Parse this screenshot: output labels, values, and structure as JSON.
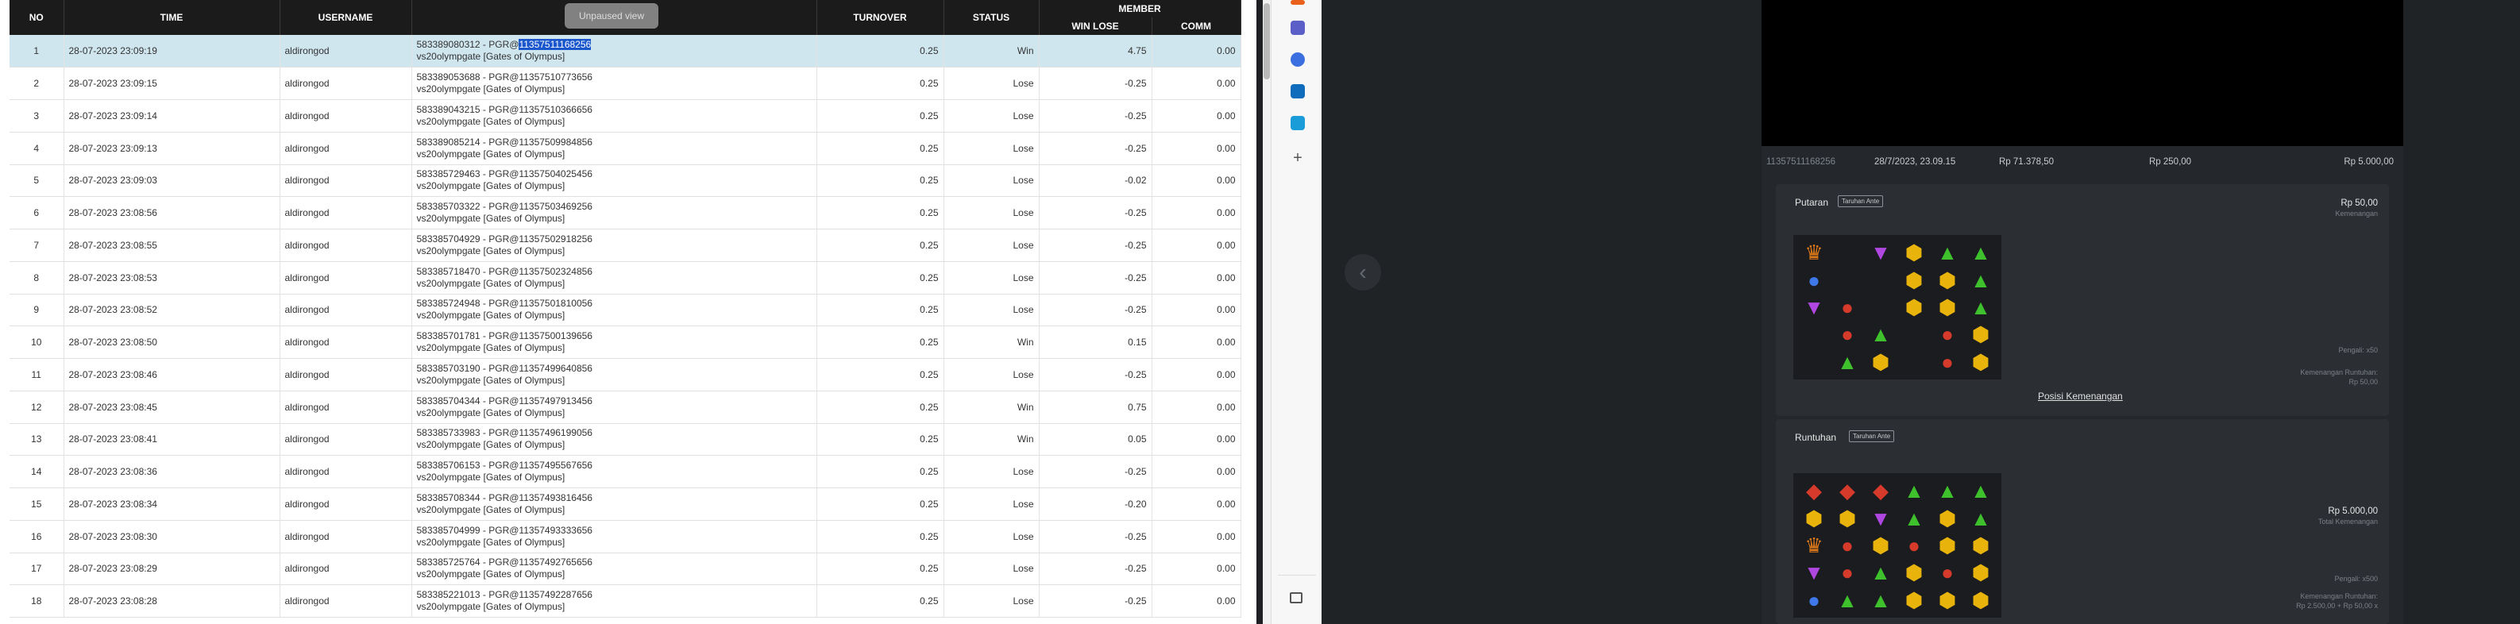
{
  "table": {
    "headers": {
      "no": "NO",
      "time": "TIME",
      "username": "USERNAME",
      "info": "",
      "turnover": "TURNOVER",
      "status": "STATUS",
      "member": "MEMBER",
      "win_lose": "WIN LOSE",
      "comm": "COMM"
    },
    "tooltip": "Unpaused view",
    "rows": [
      {
        "no": "1",
        "time": "28-07-2023 23:09:19",
        "user": "aldirongod",
        "l1a": "583389080312 - PGR@",
        "l1b": "11357511168256",
        "l2": "vs20olympgate [Gates of Olympus]",
        "turnover": "0.25",
        "status": "Win",
        "winlose": "4.75",
        "comm": "0.00"
      },
      {
        "no": "2",
        "time": "28-07-2023 23:09:15",
        "user": "aldirongod",
        "l1a": "583389053688 - PGR@11357510773656",
        "l1b": "",
        "l2": "vs20olympgate [Gates of Olympus]",
        "turnover": "0.25",
        "status": "Lose",
        "winlose": "-0.25",
        "comm": "0.00"
      },
      {
        "no": "3",
        "time": "28-07-2023 23:09:14",
        "user": "aldirongod",
        "l1a": "583389043215 - PGR@11357510366656",
        "l1b": "",
        "l2": "vs20olympgate [Gates of Olympus]",
        "turnover": "0.25",
        "status": "Lose",
        "winlose": "-0.25",
        "comm": "0.00"
      },
      {
        "no": "4",
        "time": "28-07-2023 23:09:13",
        "user": "aldirongod",
        "l1a": "583389085214 - PGR@11357509984856",
        "l1b": "",
        "l2": "vs20olympgate [Gates of Olympus]",
        "turnover": "0.25",
        "status": "Lose",
        "winlose": "-0.25",
        "comm": "0.00"
      },
      {
        "no": "5",
        "time": "28-07-2023 23:09:03",
        "user": "aldirongod",
        "l1a": "583385729463 - PGR@11357504025456",
        "l1b": "",
        "l2": "vs20olympgate [Gates of Olympus]",
        "turnover": "0.25",
        "status": "Lose",
        "winlose": "-0.02",
        "comm": "0.00"
      },
      {
        "no": "6",
        "time": "28-07-2023 23:08:56",
        "user": "aldirongod",
        "l1a": "583385703322 - PGR@11357503469256",
        "l1b": "",
        "l2": "vs20olympgate [Gates of Olympus]",
        "turnover": "0.25",
        "status": "Lose",
        "winlose": "-0.25",
        "comm": "0.00"
      },
      {
        "no": "7",
        "time": "28-07-2023 23:08:55",
        "user": "aldirongod",
        "l1a": "583385704929 - PGR@11357502918256",
        "l1b": "",
        "l2": "vs20olympgate [Gates of Olympus]",
        "turnover": "0.25",
        "status": "Lose",
        "winlose": "-0.25",
        "comm": "0.00"
      },
      {
        "no": "8",
        "time": "28-07-2023 23:08:53",
        "user": "aldirongod",
        "l1a": "583385718470 - PGR@11357502324856",
        "l1b": "",
        "l2": "vs20olympgate [Gates of Olympus]",
        "turnover": "0.25",
        "status": "Lose",
        "winlose": "-0.25",
        "comm": "0.00"
      },
      {
        "no": "9",
        "time": "28-07-2023 23:08:52",
        "user": "aldirongod",
        "l1a": "583385724948 - PGR@11357501810056",
        "l1b": "",
        "l2": "vs20olympgate [Gates of Olympus]",
        "turnover": "0.25",
        "status": "Lose",
        "winlose": "-0.25",
        "comm": "0.00"
      },
      {
        "no": "10",
        "time": "28-07-2023 23:08:50",
        "user": "aldirongod",
        "l1a": "583385701781 - PGR@11357500139656",
        "l1b": "",
        "l2": "vs20olympgate [Gates of Olympus]",
        "turnover": "0.25",
        "status": "Win",
        "winlose": "0.15",
        "comm": "0.00"
      },
      {
        "no": "11",
        "time": "28-07-2023 23:08:46",
        "user": "aldirongod",
        "l1a": "583385703190 - PGR@11357499640856",
        "l1b": "",
        "l2": "vs20olympgate [Gates of Olympus]",
        "turnover": "0.25",
        "status": "Lose",
        "winlose": "-0.25",
        "comm": "0.00"
      },
      {
        "no": "12",
        "time": "28-07-2023 23:08:45",
        "user": "aldirongod",
        "l1a": "583385704344 - PGR@11357497913456",
        "l1b": "",
        "l2": "vs20olympgate [Gates of Olympus]",
        "turnover": "0.25",
        "status": "Win",
        "winlose": "0.75",
        "comm": "0.00"
      },
      {
        "no": "13",
        "time": "28-07-2023 23:08:41",
        "user": "aldirongod",
        "l1a": "583385733983 - PGR@11357496199056",
        "l1b": "",
        "l2": "vs20olympgate [Gates of Olympus]",
        "turnover": "0.25",
        "status": "Win",
        "winlose": "0.05",
        "comm": "0.00"
      },
      {
        "no": "14",
        "time": "28-07-2023 23:08:36",
        "user": "aldirongod",
        "l1a": "583385706153 - PGR@11357495567656",
        "l1b": "",
        "l2": "vs20olympgate [Gates of Olympus]",
        "turnover": "0.25",
        "status": "Lose",
        "winlose": "-0.25",
        "comm": "0.00"
      },
      {
        "no": "15",
        "time": "28-07-2023 23:08:34",
        "user": "aldirongod",
        "l1a": "583385708344 - PGR@11357493816456",
        "l1b": "",
        "l2": "vs20olympgate [Gates of Olympus]",
        "turnover": "0.25",
        "status": "Lose",
        "winlose": "-0.20",
        "comm": "0.00"
      },
      {
        "no": "16",
        "time": "28-07-2023 23:08:30",
        "user": "aldirongod",
        "l1a": "583385704999 - PGR@11357493333656",
        "l1b": "",
        "l2": "vs20olympgate [Gates of Olympus]",
        "turnover": "0.25",
        "status": "Lose",
        "winlose": "-0.25",
        "comm": "0.00"
      },
      {
        "no": "17",
        "time": "28-07-2023 23:08:29",
        "user": "aldirongod",
        "l1a": "583385725764 - PGR@11357492765656",
        "l1b": "",
        "l2": "vs20olympgate [Gates of Olympus]",
        "turnover": "0.25",
        "status": "Lose",
        "winlose": "-0.25",
        "comm": "0.00"
      },
      {
        "no": "18",
        "time": "28-07-2023 23:08:28",
        "user": "aldirongod",
        "l1a": "583385221013 - PGR@11357492287656",
        "l1b": "",
        "l2": "vs20olympgate [Gates of Olympus]",
        "turnover": "0.25",
        "status": "Lose",
        "winlose": "-0.25",
        "comm": "0.00"
      }
    ]
  },
  "game": {
    "summary": {
      "id": "11357511168256",
      "time": "28/7/2023, 23.09.15",
      "balance": "Rp 71.378,50",
      "bet": "Rp 250,00",
      "win": "Rp 5.000,00"
    },
    "putaran": {
      "title": "Putaran",
      "tag": "Taruhan Ante",
      "amount": "Rp 50,00",
      "amount_sub": "Kemenangan",
      "pengali": "Pengali: x50",
      "runtuhan_label": "Kemenangan Runtuhan:",
      "runtuhan_value": "Rp 50,00",
      "posisi_link": "Posisi Kemenangan"
    },
    "runtuhan": {
      "title": "Runtuhan",
      "tag": "Taruhan Ante",
      "total": "Rp 5.000,00",
      "total_sub": "Total Kemenangan",
      "pengali": "Pengali: x500",
      "runtuhan_label": "Kemenangan Runtuhan:",
      "runtuhan_value": "Rp 2.500,00 + Rp 50,00 x"
    }
  },
  "icons": [
    "left-arrow-icon",
    "teams-icon",
    "copilot-icon",
    "outlook-icon",
    "shopping-icon",
    "add-icon",
    "sidebar-toggle-icon"
  ],
  "colors": {
    "win": "#2e8b2e",
    "lose": "#e02020",
    "highlight": "#1a56cc",
    "selected_row": "#cfe6ee"
  }
}
